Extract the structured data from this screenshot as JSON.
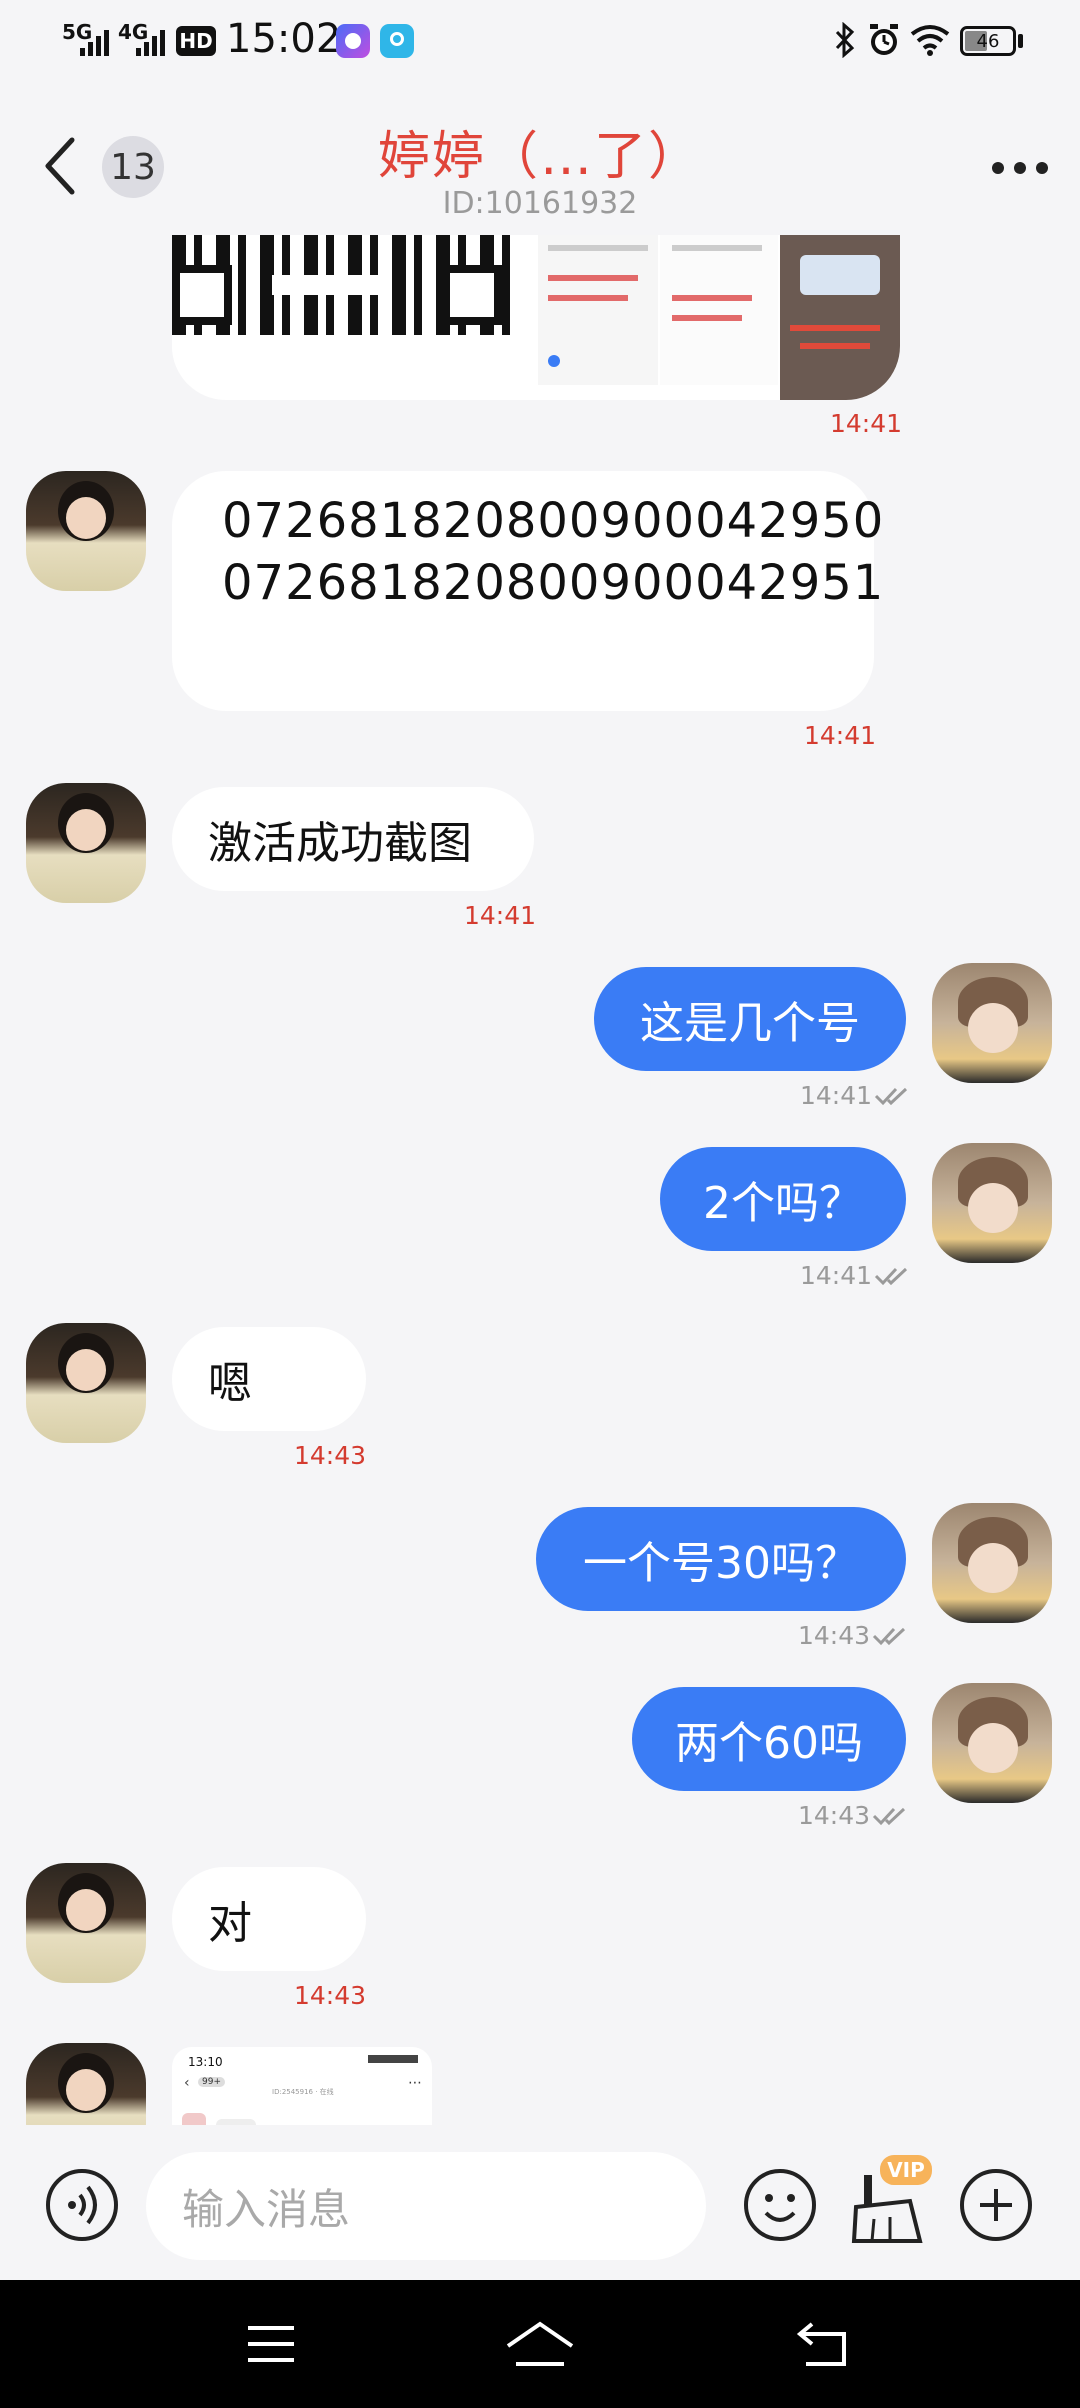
{
  "status_bar": {
    "network1": "5G",
    "network2": "4G",
    "hd_label": "HD",
    "time": "15:02",
    "battery": "46"
  },
  "header": {
    "back_count": "13",
    "title": "婷婷（…了）",
    "user_id": "ID:10161932"
  },
  "messages": [
    {
      "side": "left",
      "type": "image",
      "time": "14:41"
    },
    {
      "side": "left",
      "type": "text",
      "lines": [
        "072681820800900042950",
        "072681820800900042951"
      ],
      "time": "14:41"
    },
    {
      "side": "left",
      "type": "text",
      "text": "激活成功截图",
      "time": "14:41"
    },
    {
      "side": "right",
      "type": "text",
      "text": "这是几个号",
      "time": "14:41"
    },
    {
      "side": "right",
      "type": "text",
      "text": "2个吗？",
      "time": "14:41"
    },
    {
      "side": "left",
      "type": "text",
      "text": "嗯",
      "time": "14:43"
    },
    {
      "side": "right",
      "type": "text",
      "text": "一个号30吗？",
      "time": "14:43"
    },
    {
      "side": "right",
      "type": "text",
      "text": "两个60吗",
      "time": "14:43"
    },
    {
      "side": "left",
      "type": "text",
      "text": "对",
      "time": "14:43"
    },
    {
      "side": "left",
      "type": "image_partial",
      "inner_time": "13:10",
      "inner_badge": "99+",
      "inner_id": "ID:2545916 · 在线"
    }
  ],
  "input_bar": {
    "placeholder": "输入消息",
    "vip_label": "VIP"
  },
  "colors": {
    "accent_blue": "#3a7cf5",
    "title_red": "#e0453a",
    "time_red": "#d43b2f",
    "background": "#f5f5f7"
  },
  "icons": [
    "signal-icon",
    "hd-icon",
    "camera-app-icon",
    "hotspot-app-icon",
    "bluetooth-icon",
    "alarm-icon",
    "wifi-icon",
    "battery-icon",
    "back-arrow-icon",
    "more-icon",
    "voice-icon",
    "emoji-icon",
    "broom-icon",
    "plus-icon",
    "menu-nav-icon",
    "home-nav-icon",
    "back-nav-icon",
    "read-check-icon"
  ]
}
